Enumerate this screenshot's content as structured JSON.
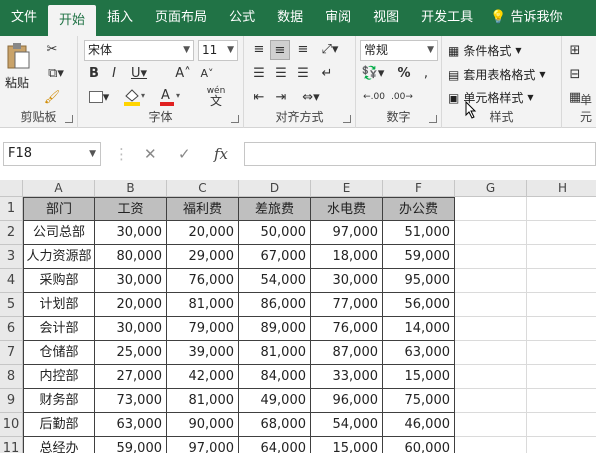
{
  "tabs": [
    {
      "label": "文件",
      "active": false
    },
    {
      "label": "开始",
      "active": true
    },
    {
      "label": "插入",
      "active": false
    },
    {
      "label": "页面布局",
      "active": false
    },
    {
      "label": "公式",
      "active": false
    },
    {
      "label": "数据",
      "active": false
    },
    {
      "label": "审阅",
      "active": false
    },
    {
      "label": "视图",
      "active": false
    },
    {
      "label": "开发工具",
      "active": false
    }
  ],
  "tell_me": "告诉我你",
  "ribbon": {
    "clipboard": {
      "paste_label": "粘贴",
      "group_label": "剪贴板"
    },
    "font": {
      "font_name": "宋体",
      "font_size": "11",
      "group_label": "字体",
      "wen": "wén",
      "wen_sub": "文"
    },
    "alignment": {
      "group_label": "对齐方式"
    },
    "number": {
      "format": "常规",
      "group_label": "数字"
    },
    "styles": {
      "conditional": "条件格式",
      "table_format": "套用表格格式",
      "cell_styles": "单元格样式",
      "group_label": "样式"
    },
    "cells": {
      "group_label": "单元"
    }
  },
  "formula_bar": {
    "name_box": "F18",
    "formula": ""
  },
  "colors": {
    "brand": "#217346",
    "font_color": "#e02020",
    "fill_color": "#ffd400",
    "header_fill": "#bfbfbf"
  },
  "columns": [
    "A",
    "B",
    "C",
    "D",
    "E",
    "F",
    "G",
    "H"
  ],
  "rows": [
    "1",
    "2",
    "3",
    "4",
    "5",
    "6",
    "7",
    "8",
    "9",
    "10",
    "11"
  ],
  "table": {
    "headers": [
      "部门",
      "工资",
      "福利费",
      "差旅费",
      "水电费",
      "办公费"
    ],
    "data": [
      [
        "公司总部",
        "30,000",
        "20,000",
        "50,000",
        "97,000",
        "51,000"
      ],
      [
        "人力资源部",
        "80,000",
        "29,000",
        "67,000",
        "18,000",
        "59,000"
      ],
      [
        "采购部",
        "30,000",
        "76,000",
        "54,000",
        "30,000",
        "95,000"
      ],
      [
        "计划部",
        "20,000",
        "81,000",
        "86,000",
        "77,000",
        "56,000"
      ],
      [
        "会计部",
        "30,000",
        "79,000",
        "89,000",
        "76,000",
        "14,000"
      ],
      [
        "仓储部",
        "25,000",
        "39,000",
        "81,000",
        "87,000",
        "63,000"
      ],
      [
        "内控部",
        "27,000",
        "42,000",
        "84,000",
        "33,000",
        "15,000"
      ],
      [
        "财务部",
        "73,000",
        "81,000",
        "49,000",
        "96,000",
        "75,000"
      ],
      [
        "后勤部",
        "63,000",
        "90,000",
        "68,000",
        "54,000",
        "46,000"
      ],
      [
        "总经办",
        "59,000",
        "97,000",
        "64,000",
        "15,000",
        "60,000"
      ]
    ]
  }
}
